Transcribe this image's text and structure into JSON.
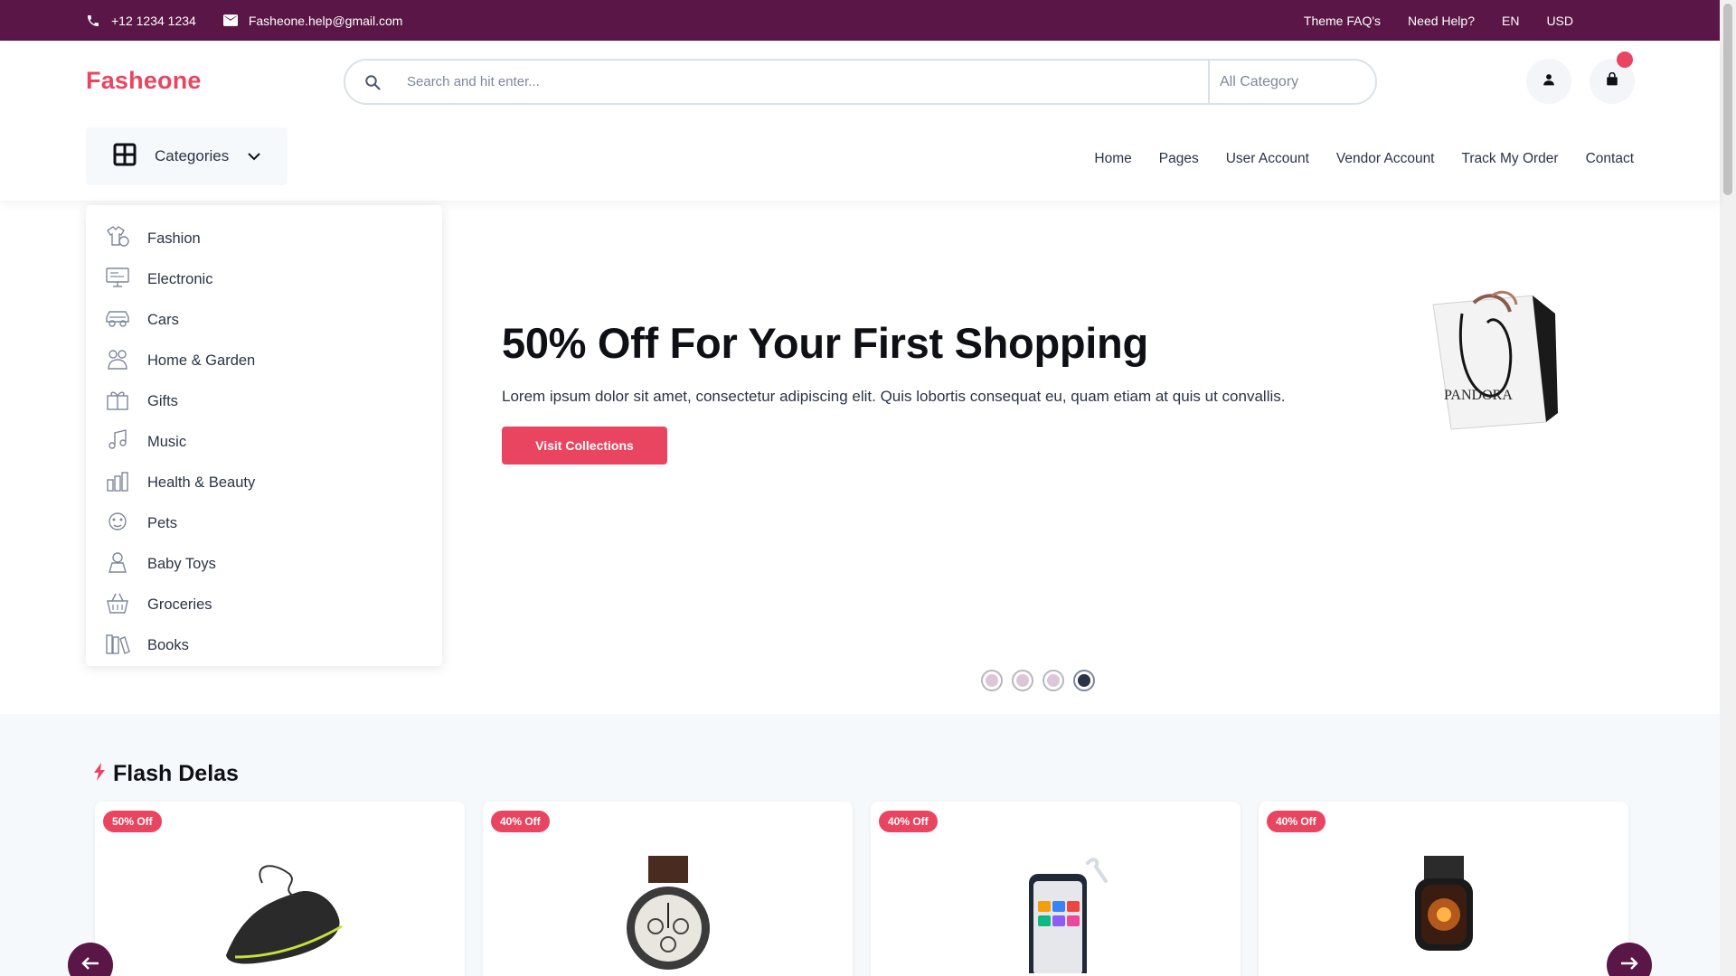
{
  "topbar": {
    "phone": "+12 1234 1234",
    "email": "Fasheone.help@gmail.com",
    "links": [
      "Theme FAQ's",
      "Need Help?",
      "EN",
      "USD"
    ]
  },
  "header": {
    "logo": "Fasheone",
    "search_placeholder": "Search and hit enter...",
    "category_select": "All Category",
    "categories_button": "Categories",
    "nav": [
      "Home",
      "Pages",
      "User Account",
      "Vendor Account",
      "Track My Order",
      "Contact"
    ]
  },
  "category_menu": [
    {
      "label": "Fashion",
      "icon": "fashion-icon"
    },
    {
      "label": "Electronic",
      "icon": "electronic-icon"
    },
    {
      "label": "Cars",
      "icon": "car-icon"
    },
    {
      "label": "Home & Garden",
      "icon": "home-garden-icon"
    },
    {
      "label": "Gifts",
      "icon": "gift-icon"
    },
    {
      "label": "Music",
      "icon": "music-icon"
    },
    {
      "label": "Health & Beauty",
      "icon": "health-beauty-icon"
    },
    {
      "label": "Pets",
      "icon": "pets-icon"
    },
    {
      "label": "Baby Toys",
      "icon": "baby-toys-icon"
    },
    {
      "label": "Groceries",
      "icon": "groceries-icon"
    },
    {
      "label": "Books",
      "icon": "books-icon"
    }
  ],
  "hero": {
    "title": "50% Off For Your First Shopping",
    "text": "Lorem ipsum dolor sit amet, consectetur adipiscing elit. Quis lobortis consequat eu, quam etiam at quis ut convallis.",
    "button": "Visit Collections",
    "bag_brand": "PANDORA",
    "slides": 4,
    "active_slide": 4
  },
  "flash": {
    "title": "Flash Delas",
    "products": [
      {
        "badge": "50% Off",
        "image": "sneaker"
      },
      {
        "badge": "40% Off",
        "image": "watch"
      },
      {
        "badge": "40% Off",
        "image": "phone"
      },
      {
        "badge": "40% Off",
        "image": "smartwatch"
      }
    ]
  },
  "colors": {
    "topbar": "#5a1646",
    "accent": "#e94560",
    "text": "#2b3445",
    "section_bg": "#f6f9fc"
  }
}
